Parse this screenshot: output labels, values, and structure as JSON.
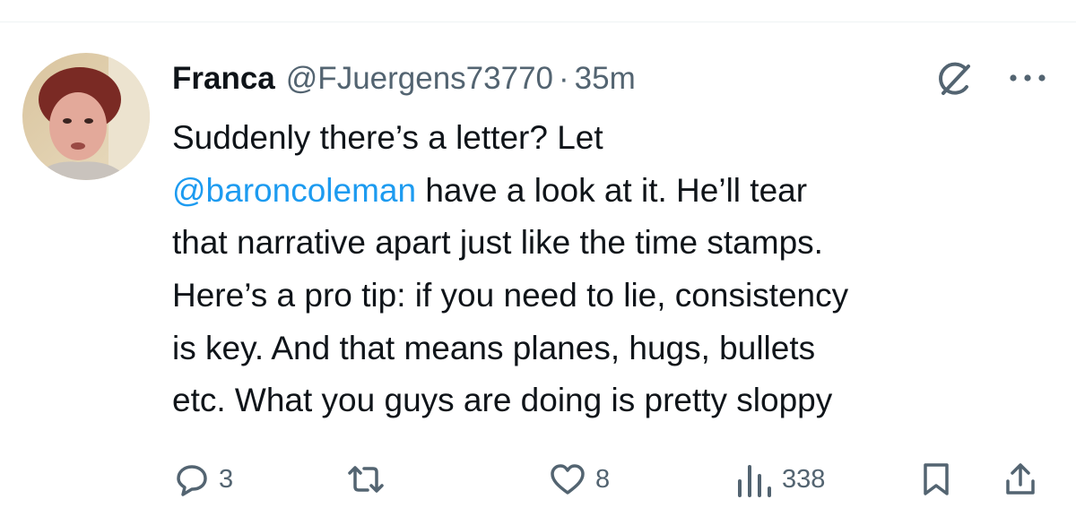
{
  "tweet": {
    "author": {
      "display_name": "Franca",
      "handle": "@FJuergens73770"
    },
    "separator": "·",
    "timestamp": "35m",
    "text_lines": [
      [
        {
          "text": "Suddenly there’s a letter? Let",
          "mention": false
        }
      ],
      [
        {
          "text": "@baroncoleman",
          "mention": true
        },
        {
          "text": " have a look at it. He’ll tear",
          "mention": false
        }
      ],
      [
        {
          "text": "that narrative apart just like the time stamps.",
          "mention": false
        }
      ],
      [
        {
          "text": "Here’s a pro tip: if you need to lie, consistency",
          "mention": false
        }
      ],
      [
        {
          "text": "is key. And that means planes, hugs, bullets",
          "mention": false
        }
      ],
      [
        {
          "text": "etc. What you guys are doing is pretty sloppy",
          "mention": false
        }
      ]
    ]
  },
  "actions": {
    "replies": "3",
    "retweets": "",
    "likes": "8",
    "views": "338"
  },
  "icons": {
    "header": [
      "grok-icon",
      "more-icon"
    ],
    "actions": [
      "reply-icon",
      "retweet-icon",
      "like-icon",
      "views-icon",
      "bookmark-icon",
      "share-icon"
    ]
  },
  "colors": {
    "text": "#0f1419",
    "secondary": "#536471",
    "mention": "#1d9bf0"
  }
}
